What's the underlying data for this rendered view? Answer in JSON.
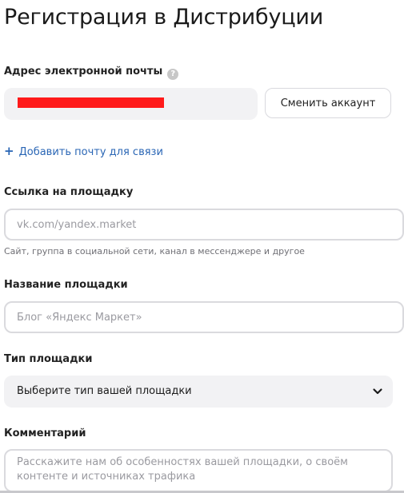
{
  "page": {
    "title": "Регистрация в Дистрибуции"
  },
  "email": {
    "label": "Адрес электронной почты",
    "help_icon": "question-circle-icon",
    "switch_account_label": "Сменить аккаунт",
    "add_contact_email_label": "Добавить почту для связи",
    "add_icon": "plus-icon"
  },
  "site_link": {
    "label": "Ссылка на площадку",
    "placeholder": "vk.com/yandex.market",
    "hint": "Сайт, группа в социальной сети, канал в мессенджере и другое"
  },
  "site_name": {
    "label": "Название площадки",
    "placeholder": "Блог «Яндекс Маркет»"
  },
  "site_type": {
    "label": "Тип площадки",
    "selected": "Выберите тип вашей площадки",
    "dropdown_icon": "chevron-down-icon"
  },
  "comment": {
    "label": "Комментарий",
    "placeholder": "Расскажите нам об особенностях вашей площадки, о своём контенте и источниках трафика"
  },
  "colors": {
    "link": "#2a66b5",
    "field_bg": "#f2f2f4",
    "border": "#dadade",
    "redaction": "#ff1a1a"
  }
}
